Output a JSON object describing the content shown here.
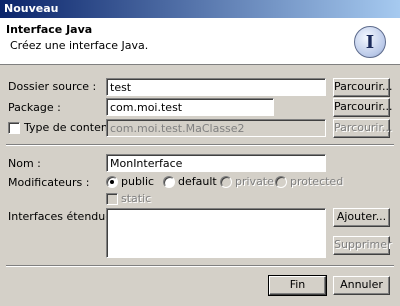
{
  "window": {
    "title": "Nouveau"
  },
  "banner": {
    "title": "Interface Java",
    "description": "Créez une interface Java.",
    "icon": "interface-icon",
    "icon_glyph": "I"
  },
  "form": {
    "source_folder": {
      "label": "Dossier source :",
      "value": "test",
      "browse_label": "Parcourir..."
    },
    "package": {
      "label": "Package :",
      "value": "com.moi.test",
      "browse_label": "Parcourir..."
    },
    "enclosing_type": {
      "label": "Type de conteneur :",
      "checked": false,
      "value": "com.moi.test.MaClasse2",
      "browse_label": "Parcourir..."
    },
    "name": {
      "label": "Nom :",
      "value": "MonInterface"
    },
    "modifiers": {
      "label": "Modificateurs :",
      "options": [
        {
          "label": "public",
          "selected": true,
          "enabled": true
        },
        {
          "label": "default",
          "selected": false,
          "enabled": true
        },
        {
          "label": "private",
          "selected": false,
          "enabled": false
        },
        {
          "label": "protected",
          "selected": false,
          "enabled": false
        }
      ],
      "static_label": "static"
    },
    "extended_interfaces": {
      "label": "Interfaces étendues :",
      "add_label": "Ajouter...",
      "remove_label": "Supprimer",
      "items": []
    }
  },
  "footer": {
    "finish_label": "Fin",
    "cancel_label": "Annuler"
  }
}
